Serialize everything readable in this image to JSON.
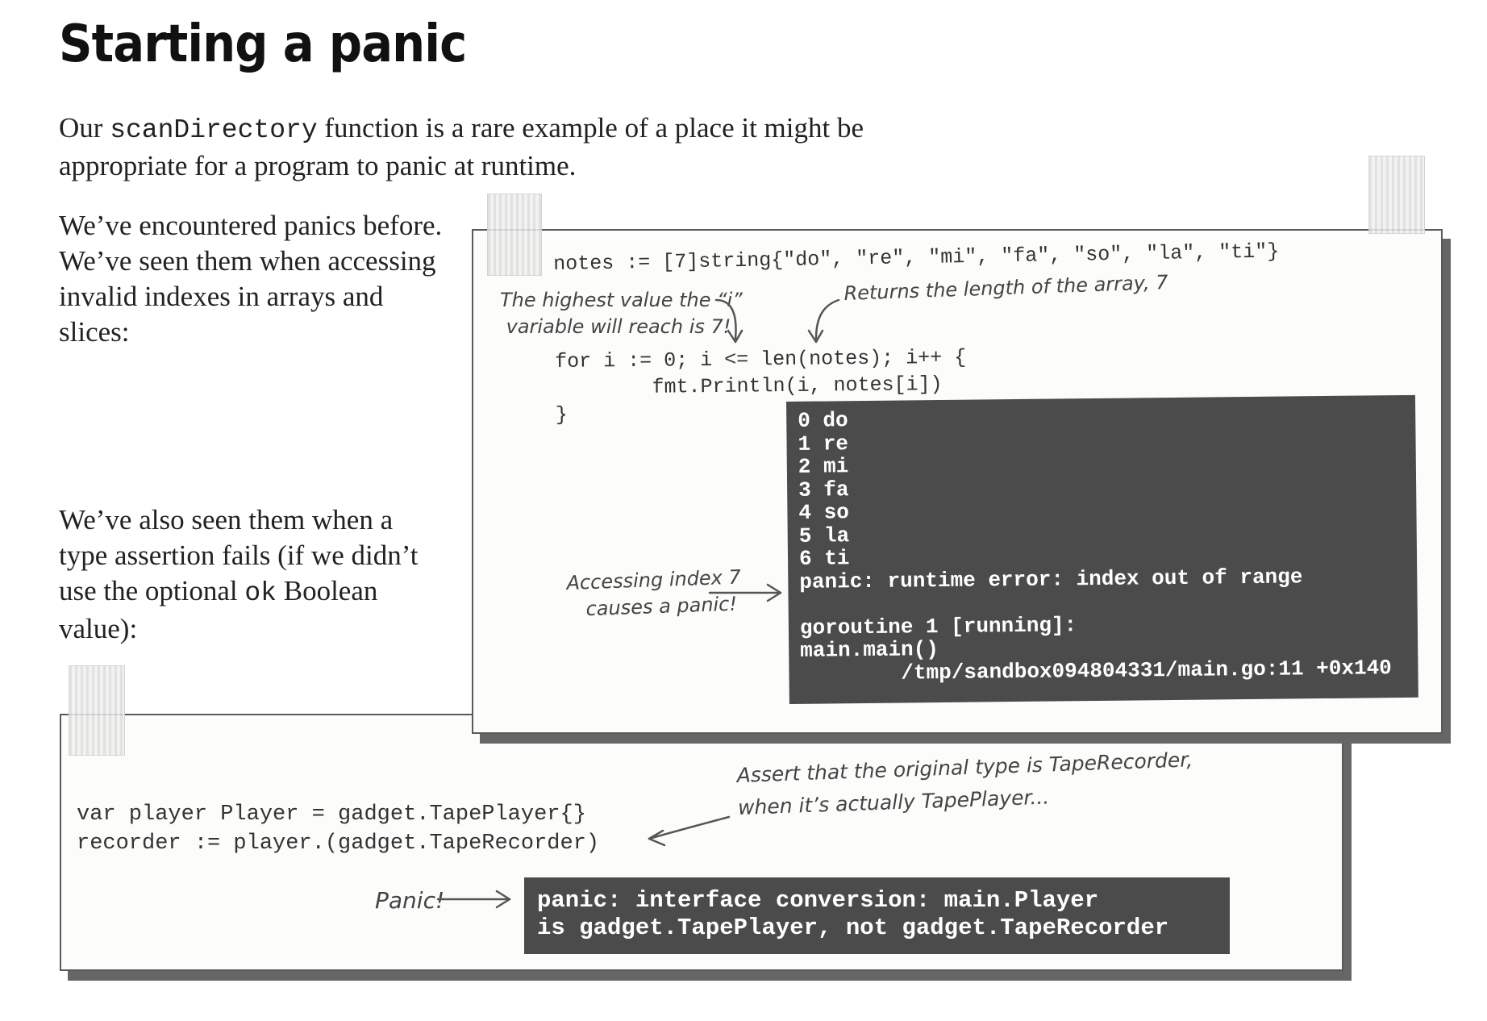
{
  "page": {
    "title": "Starting a panic",
    "intro": {
      "before": "Our ",
      "code": "scanDirectory",
      "after": " function is a rare example of a place it might be appropriate for a program to panic at runtime."
    },
    "side_text_1": "We’ve encountered panics before. We’ve seen them when accessing invalid indexes in arrays and slices:",
    "side_text_2": {
      "before": "We’ve also seen them when a type assertion fails (if we didn’t use the optional ",
      "code": "ok",
      "after": " Boolean value):"
    }
  },
  "example1": {
    "code_line1": "notes := [7]string{\"do\", \"re\", \"mi\", \"fa\", \"so\", \"la\", \"ti\"}",
    "code_loop": "for i := 0; i <= len(notes); i++ {\n        fmt.Println(i, notes[i])\n}",
    "note_highest": "The highest value the “i”\n variable will reach is 7!",
    "note_length": "Returns the length of the array, 7",
    "note_access": "Accessing index 7\n   causes a panic!",
    "terminal": "0 do\n1 re\n2 mi\n3 fa\n4 so\n5 la\n6 ti\npanic: runtime error: index out of range\n\ngoroutine 1 [running]:\nmain.main()\n        /tmp/sandbox094804331/main.go:11 +0x140"
  },
  "example2": {
    "code": "var player Player = gadget.TapePlayer{}\nrecorder := player.(gadget.TapeRecorder)",
    "note_assert": "Assert that the original type is TapeRecorder,\nwhen it’s actually TapePlayer...",
    "note_panic": "Panic!",
    "terminal": "panic: interface conversion: main.Player\nis gadget.TapePlayer, not gadget.TapeRecorder"
  }
}
